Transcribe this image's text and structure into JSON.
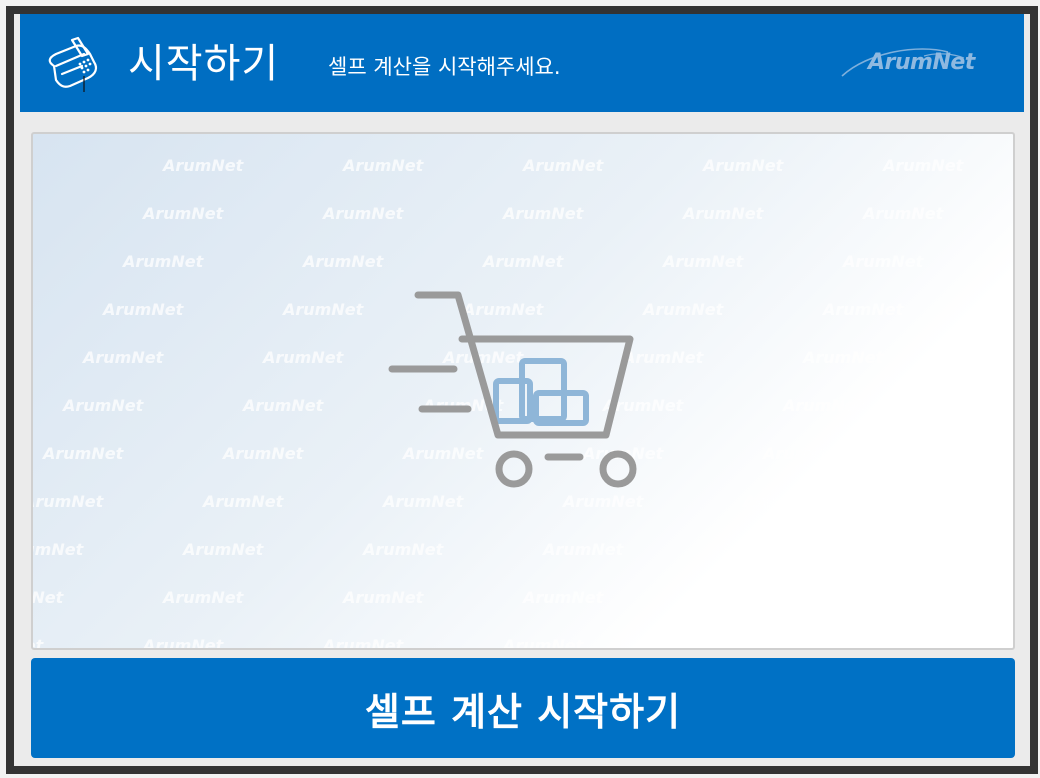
{
  "header": {
    "title": "시작하기",
    "subtitle": "셀프 계산을 시작해주세요.",
    "icon": "payment-card-terminal-icon",
    "logo_text": "ArumNet"
  },
  "main": {
    "illustration": "shopping-cart-icon",
    "watermark_text": "ArumNet"
  },
  "footer": {
    "start_button_label": "셀프 계산 시작하기"
  },
  "colors": {
    "header_bg": "#006ec2",
    "button_bg": "#0071c5",
    "frame": "#333333",
    "cart_stroke": "#9a9a9a",
    "boxes_stroke": "#8fb6d8"
  }
}
